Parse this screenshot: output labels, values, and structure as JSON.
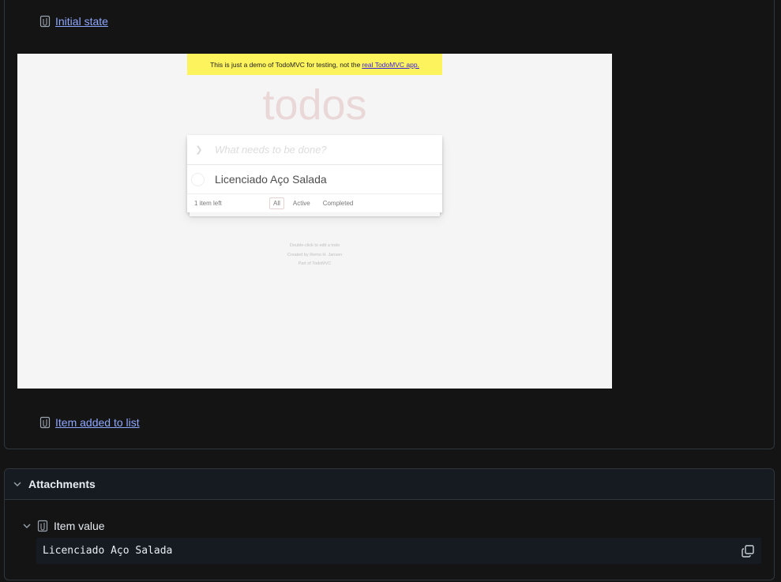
{
  "steps": {
    "initial_state": "Initial state",
    "item_added": "Item added to list"
  },
  "screenshot": {
    "banner_text": "This is just a demo of TodoMVC for testing, not the",
    "banner_link": "real TodoMVC app.",
    "title": "todos",
    "new_todo_placeholder": "What needs to be done?",
    "todo_item": "Licenciado Aço Salada",
    "items_left": "1 item left",
    "filters": [
      "All",
      "Active",
      "Completed"
    ],
    "info_lines": [
      "Double-click to edit a todo",
      "Created by Remo H. Jansen",
      "Part of TodoMVC"
    ]
  },
  "attachments": {
    "header": "Attachments",
    "item_label": "Item value",
    "item_value": "Licenciado Aço Salada"
  },
  "icons": [
    "clip-icon",
    "chevron-down-icon",
    "copy-icon"
  ]
}
